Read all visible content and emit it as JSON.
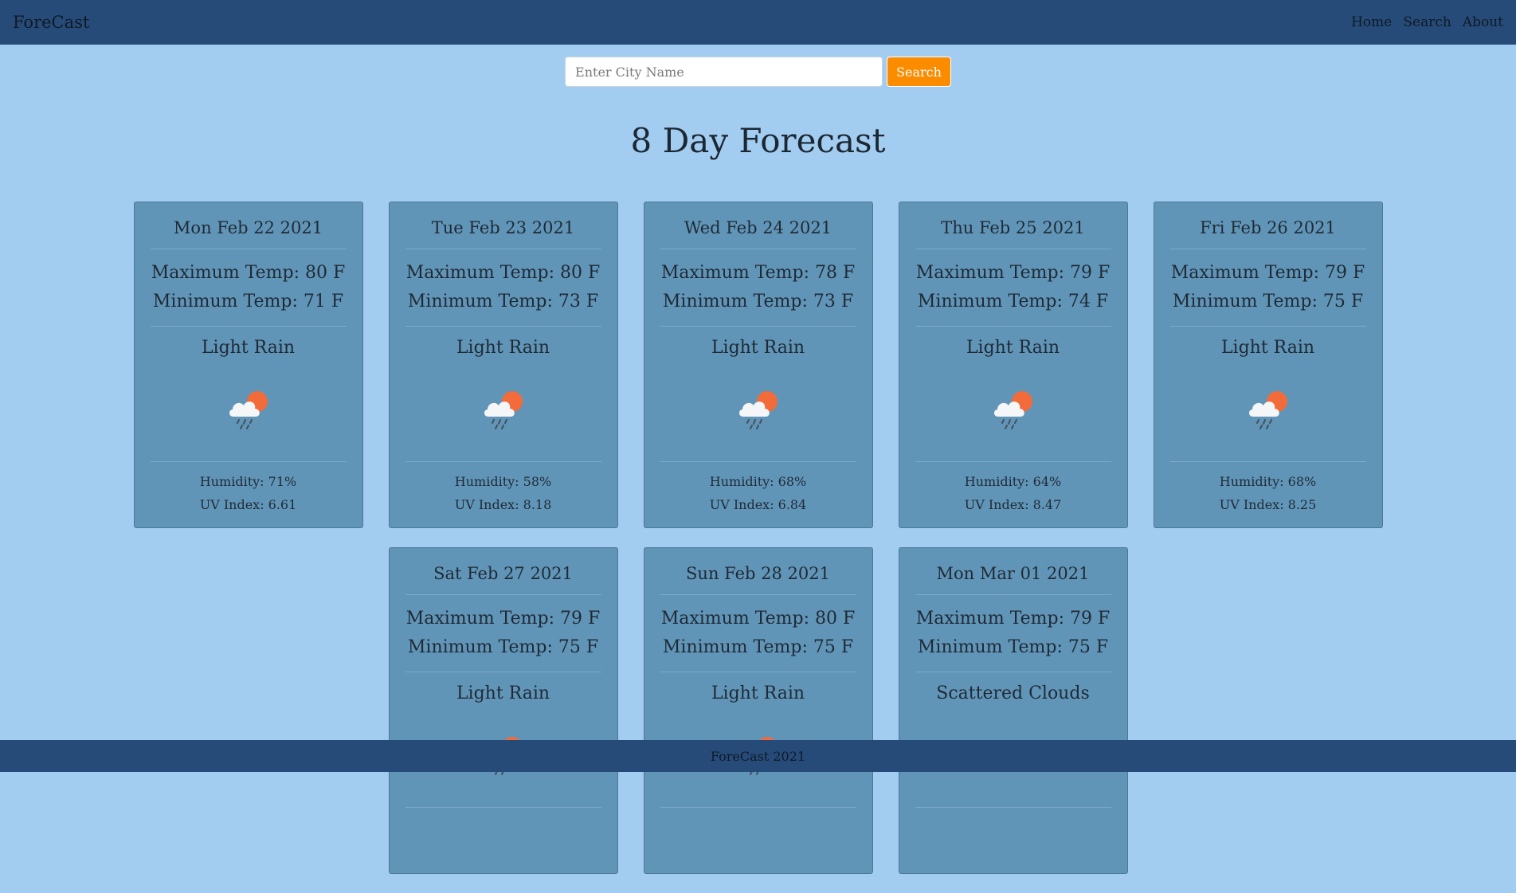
{
  "nav": {
    "brand": "ForeCast",
    "links": [
      "Home",
      "Search",
      "About"
    ]
  },
  "search": {
    "placeholder": "Enter City Name",
    "value": "",
    "button_label": "Search"
  },
  "page_title": "8 Day Forecast",
  "forecast": [
    {
      "date": "Mon Feb 22 2021",
      "max": "Maximum Temp: 80 F",
      "min": "Minimum Temp: 71 F",
      "desc": "Light Rain",
      "icon": "rain-sun-icon",
      "humidity": "Humidity: 71%",
      "uv": "UV Index: 6.61"
    },
    {
      "date": "Tue Feb 23 2021",
      "max": "Maximum Temp: 80 F",
      "min": "Minimum Temp: 73 F",
      "desc": "Light Rain",
      "icon": "rain-sun-icon",
      "humidity": "Humidity: 58%",
      "uv": "UV Index: 8.18"
    },
    {
      "date": "Wed Feb 24 2021",
      "max": "Maximum Temp: 78 F",
      "min": "Minimum Temp: 73 F",
      "desc": "Light Rain",
      "icon": "rain-sun-icon",
      "humidity": "Humidity: 68%",
      "uv": "UV Index: 6.84"
    },
    {
      "date": "Thu Feb 25 2021",
      "max": "Maximum Temp: 79 F",
      "min": "Minimum Temp: 74 F",
      "desc": "Light Rain",
      "icon": "rain-sun-icon",
      "humidity": "Humidity: 64%",
      "uv": "UV Index: 8.47"
    },
    {
      "date": "Fri Feb 26 2021",
      "max": "Maximum Temp: 79 F",
      "min": "Minimum Temp: 75 F",
      "desc": "Light Rain",
      "icon": "rain-sun-icon",
      "humidity": "Humidity: 68%",
      "uv": "UV Index: 8.25"
    },
    {
      "date": "Sat Feb 27 2021",
      "max": "Maximum Temp: 79 F",
      "min": "Minimum Temp: 75 F",
      "desc": "Light Rain",
      "icon": "rain-sun-icon",
      "humidity": "",
      "uv": ""
    },
    {
      "date": "Sun Feb 28 2021",
      "max": "Maximum Temp: 80 F",
      "min": "Minimum Temp: 75 F",
      "desc": "Light Rain",
      "icon": "rain-sun-icon",
      "humidity": "",
      "uv": ""
    },
    {
      "date": "Mon Mar 01 2021",
      "max": "Maximum Temp: 79 F",
      "min": "Minimum Temp: 75 F",
      "desc": "Scattered Clouds",
      "icon": "cloud-icon",
      "humidity": "",
      "uv": ""
    }
  ],
  "footer": "ForeCast 2021",
  "colors": {
    "navbar": "#264b78",
    "background": "#a3cdf0",
    "card": "#6195b8",
    "accent": "#fb8c00",
    "sun": "#f26b3a"
  }
}
